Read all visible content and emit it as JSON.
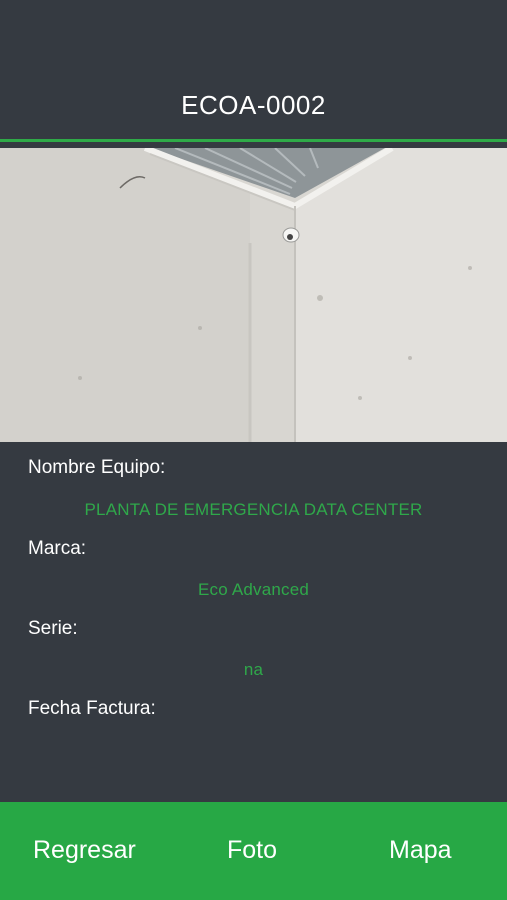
{
  "header": {
    "title": "ECOA-0002"
  },
  "photo": {
    "subject": "equipment-photo"
  },
  "details": {
    "nombre_equipo_label": "Nombre Equipo:",
    "nombre_equipo_value": "PLANTA DE EMERGENCIA DATA CENTER",
    "marca_label": "Marca:",
    "marca_value": "Eco Advanced",
    "serie_label": "Serie:",
    "serie_value": "na",
    "fecha_factura_label": "Fecha Factura:",
    "fecha_factura_value": ""
  },
  "bottom_bar": {
    "regresar_label": "Regresar",
    "foto_label": "Foto",
    "mapa_label": "Mapa"
  },
  "colors": {
    "background": "#353a41",
    "accent_green": "#27a845",
    "value_text": "#2fa84a",
    "label_text": "#ffffff"
  }
}
